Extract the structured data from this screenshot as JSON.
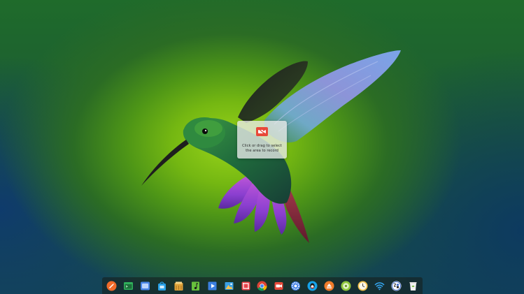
{
  "recording_hint": {
    "line1": "Click or drag to select",
    "line2": "the area to record"
  },
  "dock": {
    "items": [
      {
        "icon": "launcher-icon",
        "color": "#f06a2a"
      },
      {
        "icon": "terminal-icon",
        "color": "#2fae5a"
      },
      {
        "icon": "screen-icon",
        "color": "#4a86e8"
      },
      {
        "icon": "app-store-icon",
        "color": "#28a0e6"
      },
      {
        "icon": "file-manager-icon",
        "color": "#e0a33a"
      },
      {
        "icon": "music-icon",
        "color": "#67c13c"
      },
      {
        "icon": "video-player-icon",
        "color": "#3b7fe0"
      },
      {
        "icon": "image-viewer-icon",
        "color": "#3aa0e4"
      },
      {
        "icon": "screenshot-icon",
        "color": "#e8424a"
      },
      {
        "icon": "chrome-icon",
        "color": "#4285f4"
      },
      {
        "icon": "screen-recorder-icon",
        "color": "#e8493a"
      },
      {
        "icon": "settings-icon",
        "color": "#3d7fe6"
      },
      {
        "icon": "qq-icon",
        "color": "#16a2e8"
      },
      {
        "icon": "eject-icon",
        "color": "#f07b2a"
      },
      {
        "icon": "disk-icon",
        "color": "#8fc63c"
      },
      {
        "icon": "clock-icon",
        "color": "#f2c04a"
      },
      {
        "icon": "wifi-icon",
        "color": "#35a7f0"
      },
      {
        "icon": "input-method-icon",
        "color": "#3a66c8"
      },
      {
        "icon": "trash-icon",
        "color": "#7cc046"
      }
    ]
  }
}
